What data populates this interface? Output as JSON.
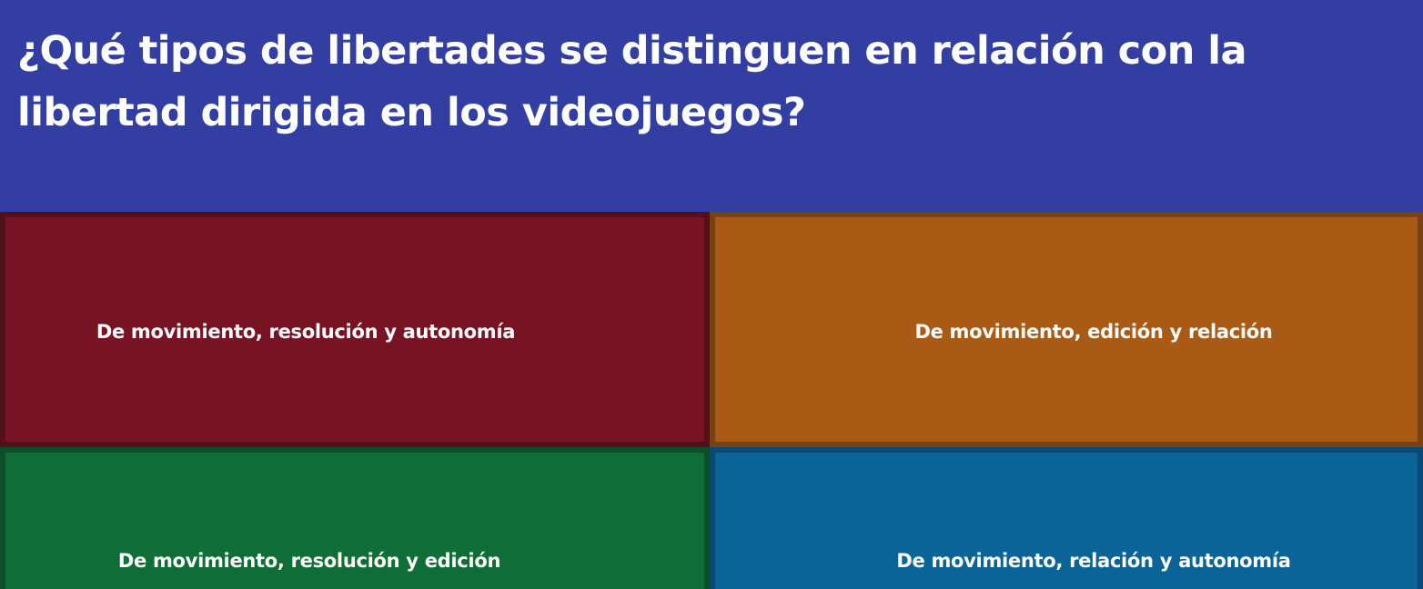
{
  "question": {
    "text": "¿Qué tipos de libertades se distinguen en relación con la libertad dirigida en los videojuegos?"
  },
  "answers": [
    {
      "label": "De movimiento, resolución y autonomía",
      "color": "#771322"
    },
    {
      "label": "De movimiento, edición y relación",
      "color": "#a95b16"
    },
    {
      "label": "De movimiento, resolución y edición",
      "color": "#0f6e35"
    },
    {
      "label": "De movimiento, relación y autonomía",
      "color": "#0a6498"
    }
  ],
  "colors": {
    "header_background": "#323ea1",
    "text": "#ffffff"
  }
}
